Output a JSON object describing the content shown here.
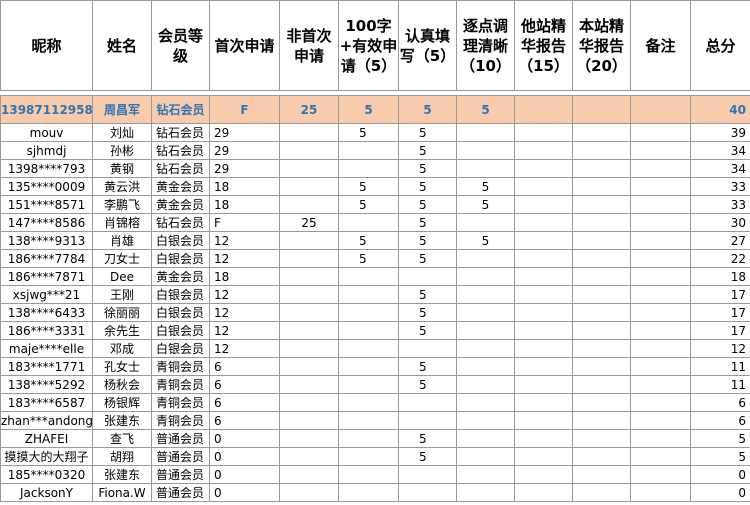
{
  "headers": [
    "昵称",
    "姓名",
    "会员等级",
    "首次申请",
    "非首次申请",
    "100字+有效申请（5）",
    "认真填写（5）",
    "逐点调理清晰（10）",
    "他站精华报告（15）",
    "本站精华报告（20）",
    "备注",
    "总分"
  ],
  "highlight": {
    "nick": "13987112958",
    "name": "周昌军",
    "level": "钻石会员",
    "first": "F",
    "nonfirst": "25",
    "c100": "5",
    "serious": "5",
    "clear": "5",
    "other": "",
    "site": "",
    "note": "",
    "total": "40"
  },
  "rows": [
    {
      "nick": "mouv",
      "name": "刘灿",
      "level": "钻石会员",
      "first": "29",
      "nonfirst": "",
      "c100": "5",
      "serious": "5",
      "clear": "",
      "other": "",
      "site": "",
      "note": "",
      "total": "39"
    },
    {
      "nick": "sjhmdj",
      "name": "孙彬",
      "level": "钻石会员",
      "first": "29",
      "nonfirst": "",
      "c100": "",
      "serious": "5",
      "clear": "",
      "other": "",
      "site": "",
      "note": "",
      "total": "34"
    },
    {
      "nick": "1398****793",
      "name": "黄钢",
      "level": "钻石会员",
      "first": "29",
      "nonfirst": "",
      "c100": "",
      "serious": "5",
      "clear": "",
      "other": "",
      "site": "",
      "note": "",
      "total": "34"
    },
    {
      "nick": "135****0009",
      "name": "黄云洪",
      "level": "黄金会员",
      "first": "18",
      "nonfirst": "",
      "c100": "5",
      "serious": "5",
      "clear": "5",
      "other": "",
      "site": "",
      "note": "",
      "total": "33"
    },
    {
      "nick": "151****8571",
      "name": "李鹏飞",
      "level": "黄金会员",
      "first": "18",
      "nonfirst": "",
      "c100": "5",
      "serious": "5",
      "clear": "5",
      "other": "",
      "site": "",
      "note": "",
      "total": "33"
    },
    {
      "nick": "147****8586",
      "name": "肖锦榕",
      "level": "钻石会员",
      "first": "F",
      "nonfirst": "25",
      "c100": "",
      "serious": "5",
      "clear": "",
      "other": "",
      "site": "",
      "note": "",
      "total": "30"
    },
    {
      "nick": "138****9313",
      "name": "肖雄",
      "level": "白银会员",
      "first": "12",
      "nonfirst": "",
      "c100": "5",
      "serious": "5",
      "clear": "5",
      "other": "",
      "site": "",
      "note": "",
      "total": "27"
    },
    {
      "nick": "186****7784",
      "name": "刀女士",
      "level": "白银会员",
      "first": "12",
      "nonfirst": "",
      "c100": "5",
      "serious": "5",
      "clear": "",
      "other": "",
      "site": "",
      "note": "",
      "total": "22"
    },
    {
      "nick": "186****7871",
      "name": "Dee",
      "level": "黄金会员",
      "first": "18",
      "nonfirst": "",
      "c100": "",
      "serious": "",
      "clear": "",
      "other": "",
      "site": "",
      "note": "",
      "total": "18"
    },
    {
      "nick": "xsjwg***21",
      "name": "王刚",
      "level": "白银会员",
      "first": "12",
      "nonfirst": "",
      "c100": "",
      "serious": "5",
      "clear": "",
      "other": "",
      "site": "",
      "note": "",
      "total": "17"
    },
    {
      "nick": "138****6433",
      "name": "徐丽丽",
      "level": "白银会员",
      "first": "12",
      "nonfirst": "",
      "c100": "",
      "serious": "5",
      "clear": "",
      "other": "",
      "site": "",
      "note": "",
      "total": "17"
    },
    {
      "nick": "186****3331",
      "name": "余先生",
      "level": "白银会员",
      "first": "12",
      "nonfirst": "",
      "c100": "",
      "serious": "5",
      "clear": "",
      "other": "",
      "site": "",
      "note": "",
      "total": "17"
    },
    {
      "nick": "maje****elle",
      "name": "邓成",
      "level": "白银会员",
      "first": "12",
      "nonfirst": "",
      "c100": "",
      "serious": "",
      "clear": "",
      "other": "",
      "site": "",
      "note": "",
      "total": "12"
    },
    {
      "nick": "183****1771",
      "name": "孔女士",
      "level": "青铜会员",
      "first": "6",
      "nonfirst": "",
      "c100": "",
      "serious": "5",
      "clear": "",
      "other": "",
      "site": "",
      "note": "",
      "total": "11"
    },
    {
      "nick": "138****5292",
      "name": "杨秋会",
      "level": "青铜会员",
      "first": "6",
      "nonfirst": "",
      "c100": "",
      "serious": "5",
      "clear": "",
      "other": "",
      "site": "",
      "note": "",
      "total": "11"
    },
    {
      "nick": "183****6587",
      "name": "杨银辉",
      "level": "青铜会员",
      "first": "6",
      "nonfirst": "",
      "c100": "",
      "serious": "",
      "clear": "",
      "other": "",
      "site": "",
      "note": "",
      "total": "6"
    },
    {
      "nick": "zhan***andong",
      "name": "张建东",
      "level": "青铜会员",
      "first": "6",
      "nonfirst": "",
      "c100": "",
      "serious": "",
      "clear": "",
      "other": "",
      "site": "",
      "note": "",
      "total": "6"
    },
    {
      "nick": "ZHAFEI",
      "name": "查飞",
      "level": "普通会员",
      "first": "0",
      "nonfirst": "",
      "c100": "",
      "serious": "5",
      "clear": "",
      "other": "",
      "site": "",
      "note": "",
      "total": "5"
    },
    {
      "nick": "摸摸大的大翔子",
      "name": "胡翔",
      "level": "普通会员",
      "first": "0",
      "nonfirst": "",
      "c100": "",
      "serious": "5",
      "clear": "",
      "other": "",
      "site": "",
      "note": "",
      "total": "5"
    },
    {
      "nick": "185****0320",
      "name": "张建东",
      "level": "普通会员",
      "first": "0",
      "nonfirst": "",
      "c100": "",
      "serious": "",
      "clear": "",
      "other": "",
      "site": "",
      "note": "",
      "total": "0"
    },
    {
      "nick": "JacksonY",
      "name": "Fiona.W",
      "level": "普通会员",
      "first": "0",
      "nonfirst": "",
      "c100": "",
      "serious": "",
      "clear": "",
      "other": "",
      "site": "",
      "note": "",
      "total": "0"
    }
  ]
}
